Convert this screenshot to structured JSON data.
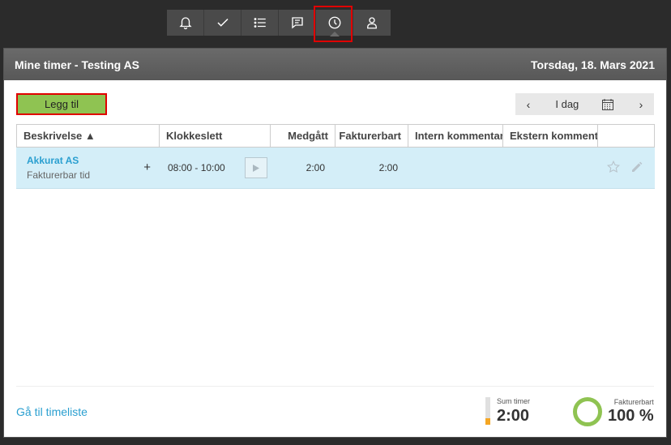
{
  "toolbar": {
    "items": [
      {
        "icon": "bell-icon"
      },
      {
        "icon": "check-icon"
      },
      {
        "icon": "list-icon"
      },
      {
        "icon": "chat-icon"
      },
      {
        "icon": "clock-icon",
        "active": true
      },
      {
        "icon": "user-icon"
      }
    ]
  },
  "panel": {
    "title": "Mine timer - Testing AS",
    "date": "Torsdag, 18. Mars 2021"
  },
  "actions": {
    "add_label": "Legg til"
  },
  "date_nav": {
    "prev": "‹",
    "label": "I dag",
    "next": "›"
  },
  "table": {
    "columns": [
      "Beskrivelse ▲",
      "Klokkeslett",
      "Medgått",
      "Fakturerbart",
      "Intern kommentar",
      "Ekstern kommentar"
    ],
    "rows": [
      {
        "project": "Akkurat AS",
        "type": "Fakturerbar tid",
        "plus": "+",
        "time": "08:00 - 10:00",
        "spent": "2:00",
        "billable": "2:00",
        "internal_comment": "",
        "external_comment": ""
      }
    ]
  },
  "footer": {
    "link": "Gå til timeliste",
    "sum_label": "Sum timer",
    "sum_value": "2:00",
    "billable_label": "Fakturerbart",
    "billable_value": "100 %"
  },
  "colors": {
    "accent": "#2a9fd0",
    "add_button": "#8fc352",
    "row_selected": "#d4eef8",
    "sum_fill": "#f5a623"
  },
  "sum_fill_fraction": 0.25
}
